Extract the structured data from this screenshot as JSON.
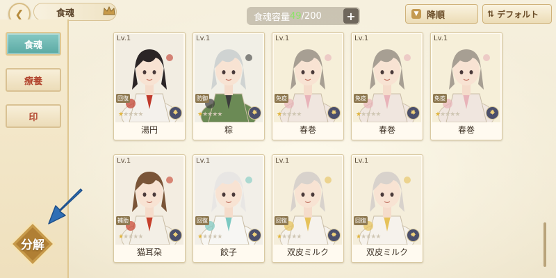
{
  "header": {
    "back_icon": "back-arrow-icon",
    "title": "食魂",
    "crown_icon": "crown-icon",
    "capacity_label": "食魂容量",
    "capacity_current": "49",
    "capacity_sep": "/200",
    "capacity_add": "+",
    "sort_label": "降順",
    "default_label": "デフォルト"
  },
  "sidebar": {
    "tabs": [
      {
        "label": "食魂",
        "active": true
      },
      {
        "label": "療養",
        "active": false
      },
      {
        "label": "印",
        "active": false
      }
    ],
    "decompose_label": "分解"
  },
  "cards": [
    {
      "level": "Lv.1",
      "role": "回復",
      "name": "湯円",
      "stars_filled": 1,
      "stars_total": 5,
      "palette": {
        "hair": "#2b2526",
        "coat": "#f4f1ec",
        "accent": "#c0392b",
        "bg": "#f2ede2"
      }
    },
    {
      "level": "Lv.1",
      "role": "防御",
      "name": "粽",
      "stars_filled": 1,
      "stars_total": 5,
      "palette": {
        "hair": "#cfd3d2",
        "coat": "#6b8a55",
        "accent": "#3c3c3c",
        "bg": "#f1efe6"
      }
    },
    {
      "level": "Lv.1",
      "role": "免疫",
      "name": "春巻",
      "stars_filled": 1,
      "stars_total": 5,
      "palette": {
        "hair": "#a79f93",
        "coat": "#f0e6df",
        "accent": "#e8b3b9",
        "bg": "#f6efd9"
      }
    },
    {
      "level": "Lv.1",
      "role": "免疫",
      "name": "春巻",
      "stars_filled": 1,
      "stars_total": 5,
      "palette": {
        "hair": "#a79f93",
        "coat": "#f0e6df",
        "accent": "#e8b3b9",
        "bg": "#f6efd9"
      }
    },
    {
      "level": "Lv.1",
      "role": "免疫",
      "name": "春巻",
      "stars_filled": 1,
      "stars_total": 5,
      "palette": {
        "hair": "#a79f93",
        "coat": "#f0e6df",
        "accent": "#e8b3b9",
        "bg": "#f6efd9"
      }
    },
    {
      "level": "Lv.1",
      "role": "補助",
      "name": "猫耳朶",
      "stars_filled": 1,
      "stars_total": 5,
      "palette": {
        "hair": "#7a5538",
        "coat": "#f3efe6",
        "accent": "#c6402c",
        "bg": "#f3ede1"
      }
    },
    {
      "level": "Lv.1",
      "role": "回復",
      "name": "餃子",
      "stars_filled": 1,
      "stars_total": 5,
      "palette": {
        "hair": "#e8e6e4",
        "coat": "#f7f6f3",
        "accent": "#7cc9c2",
        "bg": "#f2efe8"
      }
    },
    {
      "level": "Lv.1",
      "role": "回復",
      "name": "双皮ミルク",
      "stars_filled": 1,
      "stars_total": 5,
      "palette": {
        "hair": "#d8d2cc",
        "coat": "#f6f2ec",
        "accent": "#e6c25a",
        "bg": "#f5eedb"
      }
    },
    {
      "level": "Lv.1",
      "role": "回復",
      "name": "双皮ミルク",
      "stars_filled": 1,
      "stars_total": 5,
      "palette": {
        "hair": "#d8d2cc",
        "coat": "#f6f2ec",
        "accent": "#e6c25a",
        "bg": "#f5eedb"
      }
    }
  ]
}
